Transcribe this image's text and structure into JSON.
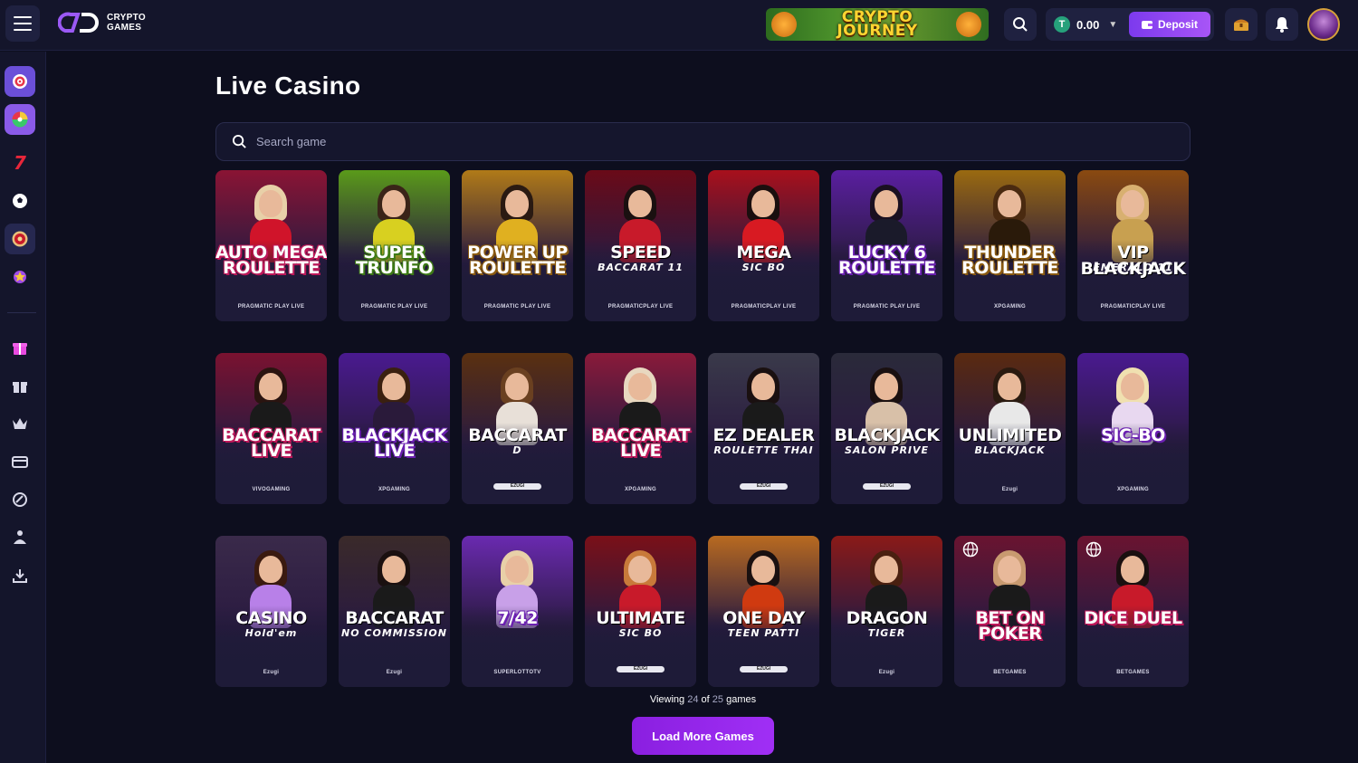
{
  "brand": {
    "line1": "CRYPTO",
    "line2": "GAMES"
  },
  "banner": {
    "line1": "CRYPTO",
    "line2": "JOURNEY"
  },
  "wallet": {
    "balance": "0.00",
    "currency_icon": "T",
    "deposit_label": "Deposit"
  },
  "page": {
    "title": "Live Casino"
  },
  "search": {
    "placeholder": "Search game"
  },
  "sidebar": {
    "items": [
      {
        "name": "target-icon"
      },
      {
        "name": "wheel-icon"
      },
      {
        "name": "seven-icon"
      },
      {
        "name": "football-icon"
      },
      {
        "name": "roulette-icon"
      },
      {
        "name": "trophy-star-icon"
      },
      {
        "name": "gift-box-icon"
      },
      {
        "name": "gift-icon"
      },
      {
        "name": "crown-icon"
      },
      {
        "name": "ticket-icon"
      },
      {
        "name": "support-chat-icon"
      },
      {
        "name": "affiliate-icon"
      },
      {
        "name": "download-icon"
      }
    ]
  },
  "games": [
    {
      "t1": "AUTO MEGA",
      "t1b": "ROULETTE",
      "t2": "",
      "provider": "PRAGMATIC PLAY LIVE",
      "theme": "pink",
      "bg": "#8a1434",
      "hair": "#e8d0a8",
      "outfit": "#d0142a"
    },
    {
      "t1": "SUPER",
      "t1b": "TRUNFO",
      "t2": "",
      "provider": "PRAGMATIC PLAY LIVE",
      "theme": "green",
      "bg": "#5a9a1a",
      "hair": "#3a2418",
      "outfit": "#d8d020"
    },
    {
      "t1": "POWER UP",
      "t1b": "ROULETTE",
      "t2": "",
      "provider": "PRAGMATIC PLAY LIVE",
      "theme": "gold",
      "bg": "#b07a18",
      "hair": "#2a1a12",
      "outfit": "#e0b020"
    },
    {
      "t1": "SPEED",
      "t1b": "",
      "t2": "BACCARAT 11",
      "provider": "PRAGMATICPLAY LIVE",
      "theme": "plain",
      "bg": "#6a0a18",
      "hair": "#1a1010",
      "outfit": "#c81a2a"
    },
    {
      "t1": "MEGA",
      "t1b": "",
      "t2": "SIC BO",
      "provider": "PRAGMATICPLAY LIVE",
      "theme": "plain",
      "bg": "#a8101c",
      "hair": "#1a0e0e",
      "outfit": "#d81a22"
    },
    {
      "t1": "LUCKY 6",
      "t1b": "ROULETTE",
      "t2": "",
      "provider": "PRAGMATIC PLAY LIVE",
      "theme": "purple",
      "bg": "#5a1fa0",
      "hair": "#1a1020",
      "outfit": "#1a1a2a"
    },
    {
      "t1": "THUNDER",
      "t1b": "ROULETTE",
      "t2": "",
      "provider": "XPGAMING",
      "theme": "gold",
      "bg": "#9a6a10",
      "hair": "#4a2a10",
      "outfit": "#2a1a0a"
    },
    {
      "t1": "VIP BLACKJACK",
      "t1b": "",
      "t2": "EMERALD 11",
      "provider": "PRAGMATICPLAY LIVE",
      "theme": "plain",
      "bg": "#8a4a10",
      "hair": "#d8b070",
      "outfit": "#c8a050"
    },
    {
      "t1": "BACCARAT",
      "t1b": "LIVE",
      "t2": "",
      "provider": "VIVOGAMING",
      "theme": "pink",
      "bg": "#7a1230",
      "hair": "#2a1410",
      "outfit": "#1a1a1a"
    },
    {
      "t1": "BLACKJACK",
      "t1b": "LIVE",
      "t2": "",
      "provider": "XPGAMING",
      "theme": "purple",
      "bg": "#4a1a90",
      "hair": "#3a2010",
      "outfit": "#2a1a3a"
    },
    {
      "t1": "BACCARAT",
      "t1b": "",
      "t2": "D",
      "provider": "EZUGI",
      "theme": "plain",
      "bg": "#5a3010",
      "hair": "#6a4020",
      "outfit": "#e8e0d8"
    },
    {
      "t1": "BACCARAT",
      "t1b": "LIVE",
      "t2": "",
      "provider": "XPGAMING",
      "theme": "pink",
      "bg": "#8a1a3a",
      "hair": "#e8d8c0",
      "outfit": "#1a1a1a"
    },
    {
      "t1": "EZ DEALER",
      "t1b": "",
      "t2": "ROULETTE THAI",
      "provider": "EZUGI",
      "theme": "plain",
      "bg": "#3a3a4a",
      "hair": "#1a1010",
      "outfit": "#1a1a1a"
    },
    {
      "t1": "BLACKJACK",
      "t1b": "",
      "t2": "SALON PRIVE",
      "provider": "EZUGI",
      "theme": "plain",
      "bg": "#2a2a3a",
      "hair": "#1a1010",
      "outfit": "#d8c0a8"
    },
    {
      "t1": "UNLIMITED",
      "t1b": "",
      "t2": "BLACKJACK",
      "provider": "Ezugi",
      "theme": "plain",
      "bg": "#5a2a10",
      "hair": "#2a1a10",
      "outfit": "#e8e8e8"
    },
    {
      "t1": "SIC-BO",
      "t1b": "",
      "t2": "",
      "provider": "XPGAMING",
      "theme": "purple",
      "bg": "#4a1a90",
      "hair": "#f0e0b0",
      "outfit": "#e8d8f0"
    },
    {
      "t1": "CASINO",
      "t1b": "",
      "t2": "Hold'em",
      "provider": "Ezugi",
      "theme": "plain",
      "bg": "#3a2a4a",
      "hair": "#3a1a10",
      "outfit": "#b880e8"
    },
    {
      "t1": "BACCARAT",
      "t1b": "",
      "t2": "NO COMMISSION",
      "provider": "Ezugi",
      "theme": "plain",
      "bg": "#3a2a2a",
      "hair": "#1a1010",
      "outfit": "#1a1a1a"
    },
    {
      "t1": "7/42",
      "t1b": "",
      "t2": "",
      "provider": "SUPERLOTTOTV",
      "theme": "purple",
      "bg": "#6a2ab0",
      "hair": "#e8d0a8",
      "outfit": "#c8a0e8"
    },
    {
      "t1": "ULTIMATE",
      "t1b": "",
      "t2": "SIC BO",
      "provider": "EZUGI",
      "theme": "plain",
      "bg": "#7a1018",
      "hair": "#c87a3a",
      "outfit": "#c81a2a"
    },
    {
      "t1": "ONE DAY",
      "t1b": "",
      "t2": "TEEN PATTI",
      "provider": "EZUGI",
      "theme": "plain",
      "bg": "#b86a20",
      "hair": "#1a1010",
      "outfit": "#d03a10"
    },
    {
      "t1": "DRAGON",
      "t1b": "",
      "t2": "TIGER",
      "provider": "Ezugi",
      "theme": "plain",
      "bg": "#8a1a18",
      "hair": "#4a2010",
      "outfit": "#1a1a1a"
    },
    {
      "t1": "BET ON",
      "t1b": "POKER",
      "t2": "",
      "provider": "BETGAMES",
      "theme": "pink",
      "bg": "#6a1430",
      "hair": "#c89a70",
      "outfit": "#1a1a1a",
      "globe": true
    },
    {
      "t1": "DICE DUEL",
      "t1b": "",
      "t2": "",
      "provider": "BETGAMES",
      "theme": "pink",
      "bg": "#6a1430",
      "hair": "#1a1010",
      "outfit": "#c81a2a",
      "globe": true
    }
  ],
  "footer": {
    "viewing_prefix": "Viewing",
    "shown": "24",
    "of": "of",
    "total": "25",
    "suffix": "games",
    "load_more": "Load More Games"
  }
}
